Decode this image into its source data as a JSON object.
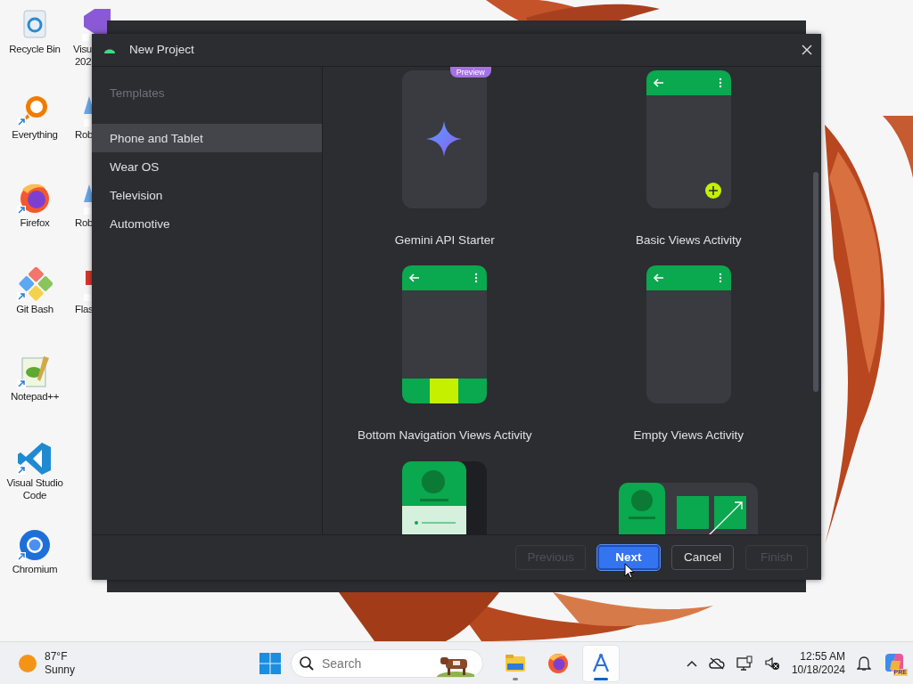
{
  "desktop_icons": [
    {
      "label": "Recycle Bin",
      "kind": "recycle"
    },
    {
      "label": "Everything",
      "kind": "everything"
    },
    {
      "label": "Firefox",
      "kind": "firefox"
    },
    {
      "label": "Git Bash",
      "kind": "git"
    },
    {
      "label": "Notepad++",
      "kind": "notepad"
    },
    {
      "label": "Visual Studio Code",
      "kind": "vscode"
    },
    {
      "label": "Chromium",
      "kind": "chromium"
    }
  ],
  "desktop_icons_partial": [
    {
      "label": "Visu",
      "kind": "vs",
      "line2": "202"
    },
    {
      "label": "Rob",
      "kind": "robot"
    },
    {
      "label": "Rob",
      "kind": "robot"
    },
    {
      "label": "Flas",
      "kind": "flash"
    }
  ],
  "dialog": {
    "title": "New Project",
    "sidebar": {
      "heading": "Templates",
      "items": [
        {
          "label": "Phone and Tablet",
          "selected": true
        },
        {
          "label": "Wear OS",
          "selected": false
        },
        {
          "label": "Television",
          "selected": false
        },
        {
          "label": "Automotive",
          "selected": false
        }
      ]
    },
    "templates": [
      {
        "kind": "gemini",
        "name": "Gemini API Starter",
        "badge": "Preview"
      },
      {
        "kind": "basic",
        "name": "Basic Views Activity"
      },
      {
        "kind": "bottomnav",
        "name": "Bottom Navigation Views Activity"
      },
      {
        "kind": "empty",
        "name": "Empty Views Activity"
      },
      {
        "kind": "login"
      },
      {
        "kind": "responsive"
      }
    ],
    "buttons": [
      {
        "label": "Previous",
        "disabled": true,
        "primary": false
      },
      {
        "label": "Next",
        "disabled": false,
        "primary": true
      },
      {
        "label": "Cancel",
        "disabled": false,
        "primary": false
      },
      {
        "label": "Finish",
        "disabled": true,
        "primary": false
      }
    ]
  },
  "taskbar": {
    "weather": {
      "temperature": "87°F",
      "condition": "Sunny"
    },
    "search": {
      "placeholder": "Search"
    },
    "apps": [
      {
        "kind": "explorer",
        "open": true,
        "active": false
      },
      {
        "kind": "firefox",
        "open": false,
        "active": false
      },
      {
        "kind": "studio",
        "open": true,
        "active": true
      }
    ],
    "time": "12:55 AM",
    "date": "10/18/2024",
    "copilot_badge": "PRE"
  }
}
